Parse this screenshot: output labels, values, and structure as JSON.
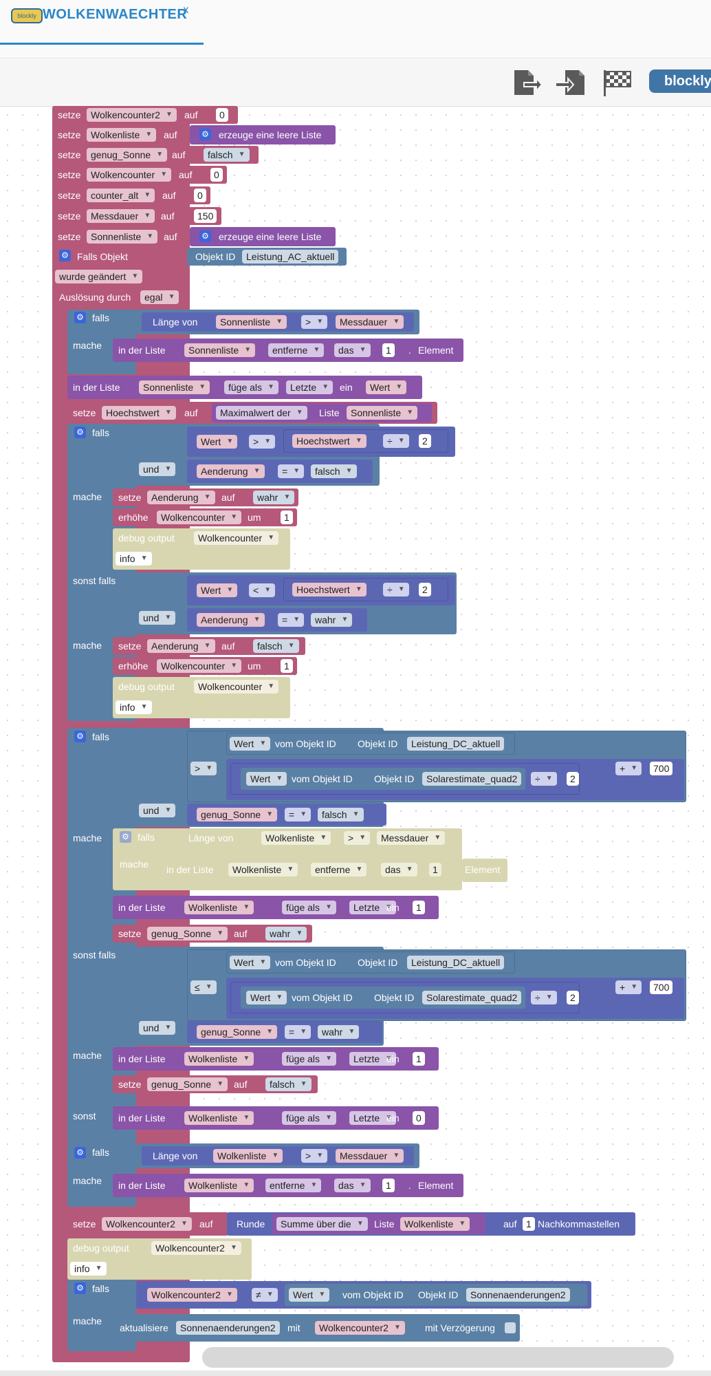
{
  "app": {
    "title": "WOLKENWAECHTER",
    "logo": "blockly",
    "close": "x",
    "blockly_label": "blockly"
  },
  "toolbar": {
    "icons": [
      "export-icon",
      "import-icon",
      "checkered-flag-icon"
    ]
  },
  "blocks": {
    "b1": {
      "setze": "setze",
      "var": "Wolkencounter2",
      "auf": "auf",
      "val": "0"
    },
    "b2": {
      "setze": "setze",
      "var": "Wolkenliste",
      "auf": "auf",
      "val": "erzeuge eine leere Liste"
    },
    "b3": {
      "setze": "setze",
      "var": "genug_Sonne",
      "auf": "auf",
      "val": "falsch"
    },
    "b4": {
      "setze": "setze",
      "var": "Wolkencounter",
      "auf": "auf",
      "val": "0"
    },
    "b5": {
      "setze": "setze",
      "var": "counter_alt",
      "auf": "auf",
      "val": "0"
    },
    "b6": {
      "setze": "setze",
      "var": "Messdauer",
      "auf": "auf",
      "val": "150"
    },
    "b7": {
      "setze": "setze",
      "var": "Sonnenliste",
      "auf": "auf",
      "val": "erzeuge eine leere Liste"
    },
    "trigger": {
      "falls_objekt": "Falls Objekt",
      "objekt_id": "Objekt ID",
      "id": "Leistung_AC_aktuell",
      "geaendert": "wurde geändert",
      "ausloesung": "Auslösung durch",
      "egal": "egal"
    },
    "if1": {
      "falls": "falls",
      "laenge": "Länge von",
      "liste": "Sonnenliste",
      "op": ">",
      "messdauer": "Messdauer",
      "mache": "mache",
      "in_der_liste": "in der Liste",
      "entferne": "entferne",
      "das": "das",
      "idx": "1",
      "dot": ".",
      "element": "Element"
    },
    "ins1": {
      "in_der_liste": "in der Liste",
      "liste": "Sonnenliste",
      "fuege": "füge als",
      "letzte": "Letzte",
      "ein": "ein",
      "wert": "Wert"
    },
    "hoechst": {
      "setze": "setze",
      "var": "Hoechstwert",
      "auf": "auf",
      "max": "Maximalwert der",
      "liste_lbl": "Liste",
      "liste": "Sonnenliste"
    },
    "if2": {
      "falls": "falls",
      "wert": "Wert",
      "gt": ">",
      "hw": "Hoechstwert",
      "div": "÷",
      "two": "2",
      "und": "und",
      "aend": "Aenderung",
      "eq": "=",
      "falsch": "falsch",
      "mache": "mache",
      "setze": "setze",
      "auf": "auf",
      "wahr": "wahr",
      "erhoehe": "erhöhe",
      "wc": "Wolkencounter",
      "um": "um",
      "one": "1",
      "debug": "debug output",
      "info": "info",
      "sonst_falls": "sonst falls",
      "lt": "<"
    },
    "if3": {
      "falls": "falls",
      "wert": "Wert",
      "vom": "vom Objekt ID",
      "objid": "Objekt ID",
      "dc": "Leistung_DC_aktuell",
      "gt": ">",
      "le": "≤",
      "quad": "Solarestimate_quad2",
      "div": "÷",
      "two": "2",
      "plus": "+",
      "n700": "700",
      "und": "und",
      "gs": "genug_Sonne",
      "eq": "=",
      "falsch": "falsch",
      "wahr": "wahr",
      "mache": "mache",
      "laenge": "Länge von",
      "wl": "Wolkenliste",
      "messdauer": "Messdauer",
      "in_der_liste": "in der Liste",
      "entferne": "entferne",
      "das": "das",
      "one": "1",
      "element": "Element",
      "fuege": "füge als",
      "letzte": "Letzte",
      "ein": "ein",
      "setze": "setze",
      "auf": "auf",
      "sonst_falls": "sonst falls",
      "sonst": "sonst",
      "zero": "0"
    },
    "if4": {
      "falls": "falls",
      "laenge": "Länge von",
      "wl": "Wolkenliste",
      "gt": ">",
      "messdauer": "Messdauer",
      "mache": "mache",
      "in_der_liste": "in der Liste",
      "entferne": "entferne",
      "das": "das",
      "one": "1",
      "dot": ".",
      "element": "Element"
    },
    "wc2": {
      "setze": "setze",
      "var": "Wolkencounter2",
      "auf": "auf",
      "runde": "Runde",
      "summe": "Summe über die",
      "liste": "Liste",
      "wl": "Wolkenliste",
      "auf2": "auf",
      "one": "1",
      "nachk": "Nachkommastellen",
      "debug": "debug output",
      "info": "info"
    },
    "if5": {
      "falls": "falls",
      "var": "Wolkencounter2",
      "ne": "≠",
      "wert": "Wert",
      "vom": "vom Objekt ID",
      "objid": "Objekt ID",
      "id": "Sonnenaenderungen2",
      "mache": "mache",
      "aktualisiere": "aktualisiere",
      "target": "Sonnenaenderungen2",
      "mit": "mit",
      "verz": "mit Verzögerung"
    }
  },
  "colors": {
    "variables": "#b55879",
    "lists": "#8a54a8",
    "logic": "#5b80a5",
    "math": "#5c67b4",
    "debug": "#d8d6b0",
    "gear": "#3b66d9",
    "accent": "#2a86c7"
  }
}
